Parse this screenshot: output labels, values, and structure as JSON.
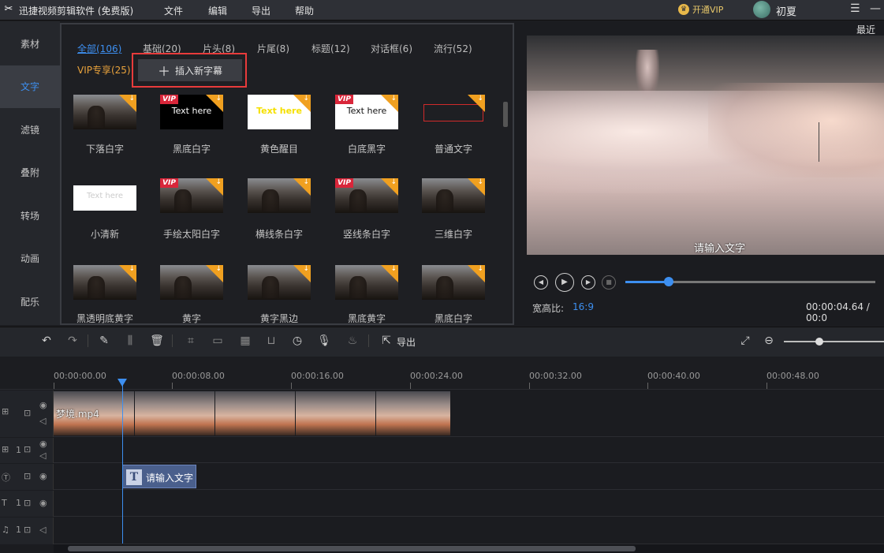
{
  "app": {
    "title": "迅捷视频剪辑软件 (免费版)",
    "icon": "scissors-icon"
  },
  "menu": [
    "文件",
    "编辑",
    "导出",
    "帮助"
  ],
  "vip": {
    "label": "开通VIP"
  },
  "user": {
    "name": "初夏"
  },
  "window_controls": {
    "menu": "☰",
    "minimize": "—"
  },
  "sidebar": [
    {
      "label": "素材"
    },
    {
      "label": "文字",
      "active": true
    },
    {
      "label": "滤镜"
    },
    {
      "label": "叠附"
    },
    {
      "label": "转场"
    },
    {
      "label": "动画"
    },
    {
      "label": "配乐"
    }
  ],
  "text_panel": {
    "tabs": [
      {
        "label": "全部(106)",
        "active": true
      },
      {
        "label": "基础(20)"
      },
      {
        "label": "片头(8)"
      },
      {
        "label": "片尾(8)"
      },
      {
        "label": "标题(12)"
      },
      {
        "label": "对话框(6)"
      },
      {
        "label": "流行(52)"
      },
      {
        "label": "VIP专享(25)",
        "vip": true
      }
    ],
    "insert_button": "插入新字幕",
    "templates": [
      {
        "label": "下落白字",
        "preview": "photo",
        "vip": false
      },
      {
        "label": "黑底白字",
        "preview": "Text here",
        "vip": true
      },
      {
        "label": "黄色醒目",
        "preview": "Text here",
        "vip": false
      },
      {
        "label": "白底黑字",
        "preview": "Text here",
        "vip": true
      },
      {
        "label": "普通文字",
        "preview": "",
        "vip": false
      },
      {
        "label": "小清新",
        "preview": "Text here",
        "vip": false
      },
      {
        "label": "手绘太阳白字",
        "preview": "photo",
        "vip": true
      },
      {
        "label": "横线条白字",
        "preview": "photo",
        "vip": false
      },
      {
        "label": "竖线条白字",
        "preview": "photo",
        "vip": true
      },
      {
        "label": "三维白字",
        "preview": "photo",
        "vip": false
      },
      {
        "label": "黑透明底黄字",
        "preview": "photo",
        "vip": false
      },
      {
        "label": "黄字",
        "preview": "photo",
        "vip": false
      },
      {
        "label": "黄字黑边",
        "preview": "photo",
        "vip": false
      },
      {
        "label": "黑底黄字",
        "preview": "photo",
        "vip": false
      },
      {
        "label": "黑底白字",
        "preview": "photo",
        "vip": false
      }
    ],
    "vip_badge": "VIP"
  },
  "preview": {
    "recent_label": "最近保",
    "overlay_text": "请输入文字",
    "aspect_label": "宽高比:",
    "aspect_value": "16:9",
    "time": "00:00:04.64 / 00:0",
    "progress": 0.17
  },
  "toolbar": {
    "export_label": "导出"
  },
  "timeline": {
    "ticks": [
      "00:00:00.00",
      "00:00:08.00",
      "00:00:16.00",
      "00:00:24.00",
      "00:00:32.00",
      "00:00:40.00",
      "00:00:48.00"
    ],
    "video_clip_name": "梦境.mp4",
    "text_clip_label": "请输入文字",
    "track_numbers": [
      "1",
      "1",
      "1",
      "1"
    ]
  },
  "colors": {
    "accent": "#3d8ff0",
    "vip": "#e8a23c",
    "highlight": "#e83b3b"
  }
}
